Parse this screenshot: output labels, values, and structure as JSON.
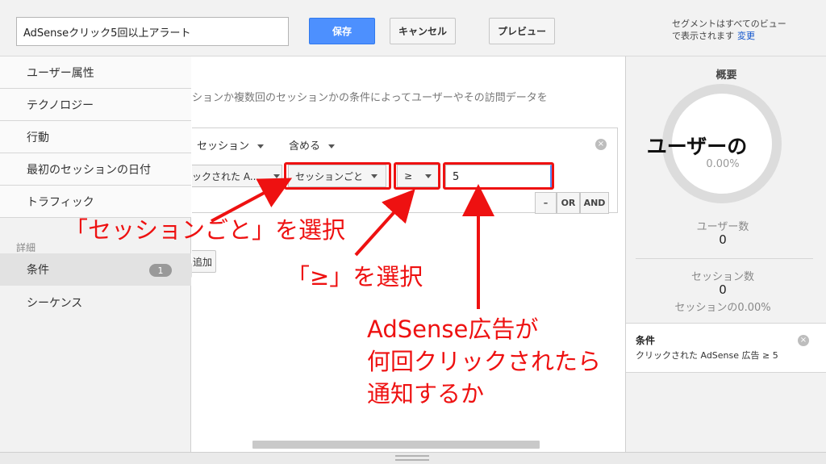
{
  "header": {
    "segment_name": "AdSenseクリック5回以上アラート",
    "save_label": "保存",
    "cancel_label": "キャンセル",
    "preview_label": "プレビュー",
    "note_line1": "セグメントはすべてのビュー",
    "note_line2": "で表示されます",
    "change_link": "変更"
  },
  "sidebar": {
    "items": [
      {
        "label": "ユーザー属性"
      },
      {
        "label": "テクノロジー"
      },
      {
        "label": "行動"
      },
      {
        "label": "最初のセッションの日付"
      },
      {
        "label": "トラフィック"
      }
    ],
    "section_label": "詳細",
    "advanced": [
      {
        "label": "条件",
        "badge": "1"
      },
      {
        "label": "シーケンス"
      }
    ]
  },
  "main": {
    "description": "ションか複数回のセッションかの条件によってユーザーやその訪問データを",
    "filter_scope": "セッション",
    "filter_mode": "含める",
    "dimension": "ックされた A...",
    "per_scope": "セッションごと",
    "operator": "≥",
    "value": "5",
    "minus_label": "–",
    "or_label": "OR",
    "and_label": "AND",
    "add_label": "追加"
  },
  "summary": {
    "title": "概要",
    "ring_label": "ユーザーの",
    "ring_percent": "0.00%",
    "users_label": "ユーザー数",
    "users_value": "0",
    "sessions_label": "セッション数",
    "sessions_value": "0",
    "sessions_percent": "セッションの0.00%",
    "condition_title": "条件",
    "condition_text": "クリックされた AdSense 広告 ≥ 5"
  },
  "annotations": {
    "per_session": "「セッションごと」を選択",
    "operator": "「≥」を選択",
    "note_line1": "AdSense広告が",
    "note_line2": "何回クリックされたら",
    "note_line3": "通知するか"
  },
  "colors": {
    "accent": "#4d90fe",
    "annotation": "#ee1111"
  }
}
